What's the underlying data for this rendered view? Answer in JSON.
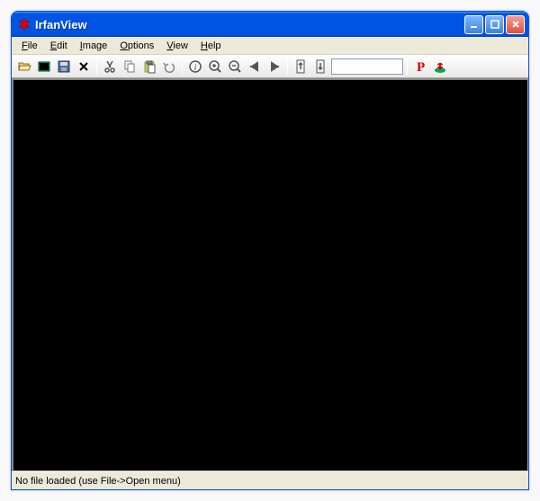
{
  "window": {
    "title": "IrfanView"
  },
  "menu": {
    "file": "File",
    "edit": "Edit",
    "image": "Image",
    "options": "Options",
    "view": "View",
    "help": "Help"
  },
  "toolbar": {
    "input_value": ""
  },
  "statusbar": {
    "message": "No file loaded (use File->Open menu)"
  }
}
